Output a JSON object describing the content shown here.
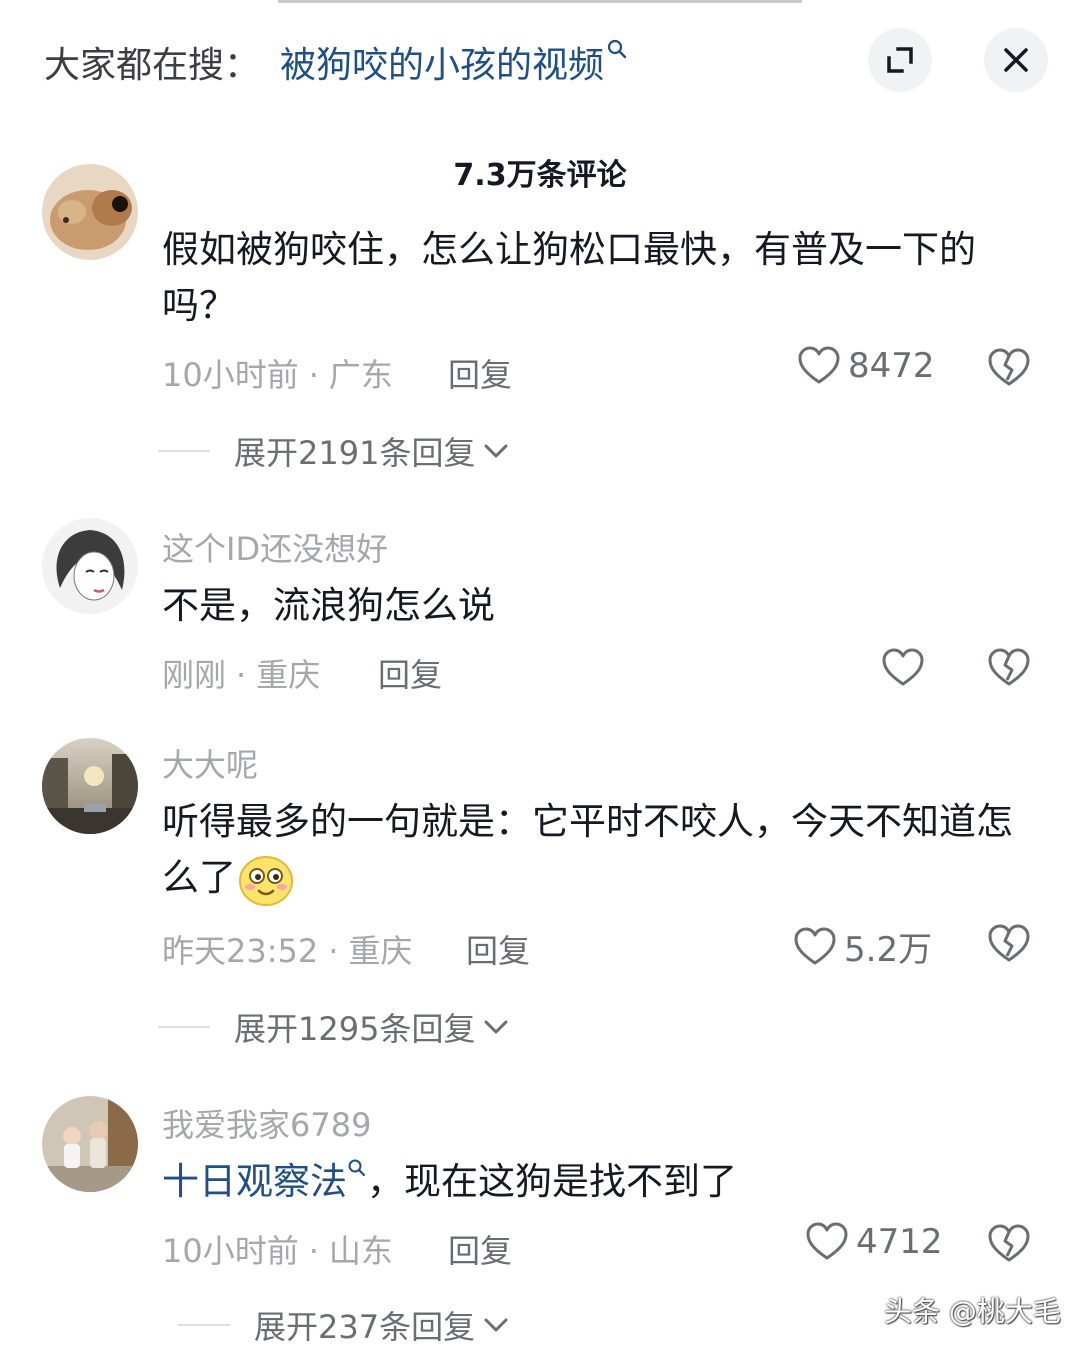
{
  "header": {
    "search_prefix": "大家都在搜：",
    "search_term": "被狗咬的小孩的视频",
    "expand_icon": "expand-icon",
    "close_icon": "close-icon"
  },
  "comment_count": "7.3万条评论",
  "comments": [
    {
      "username": "",
      "text": "假如被狗咬住，怎么让狗松口最快，有普及一下的吗？",
      "time": "10小时前",
      "location": "广东",
      "reply_label": "回复",
      "likes": "8472",
      "expand_label": "展开2191条回复"
    },
    {
      "username": "这个ID还没想好",
      "text": "不是，流浪狗怎么说",
      "time": "刚刚",
      "location": "重庆",
      "reply_label": "回复",
      "likes": "",
      "expand_label": ""
    },
    {
      "username": "大大呢",
      "text": "听得最多的一句就是：它平时不咬人，今天不知道怎么了",
      "time": "昨天23:52",
      "location": "重庆",
      "reply_label": "回复",
      "likes": "5.2万",
      "expand_label": "展开1295条回复"
    },
    {
      "username": "我爱我家6789",
      "link_text": "十日观察法",
      "text": "，现在这狗是找不到了",
      "time": "10小时前",
      "location": "山东",
      "reply_label": "回复",
      "likes": "4712",
      "expand_label": "展开237条回复"
    }
  ],
  "separator": "·",
  "watermark": "头条 @桃大毛",
  "colors": {
    "link": "#1f4f86",
    "muted": "#a6a7ac",
    "text": "#161823"
  }
}
